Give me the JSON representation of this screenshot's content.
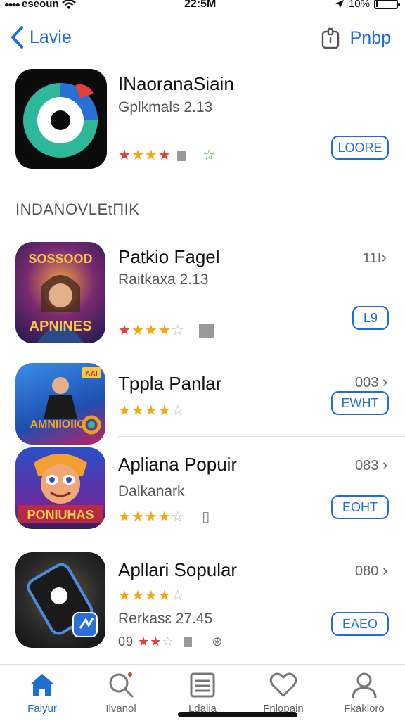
{
  "status_bar": {
    "carrier": "eseoun",
    "time": "22:5M",
    "battery": "10%"
  },
  "nav": {
    "back_label": "Lavie",
    "right_label": "Pnbp"
  },
  "featured": {
    "title": "INaoranaSiain",
    "subtitle": "Gplkmals 2.13",
    "button": "LOORE",
    "rating_text": "",
    "stars": [
      1,
      1,
      1,
      0.5,
      0
    ]
  },
  "section": {
    "header": "INDANOVLEtΠΙΚ"
  },
  "apps": [
    {
      "title": "Patkio Fagel",
      "subtitle": "Raitkaxa 2.13",
      "meta": "11І",
      "button": "L9",
      "icon_text_top": "SOSSOOD",
      "icon_text_bottom": "APNINES"
    },
    {
      "title": "Tppla Panlar",
      "subtitle": "",
      "meta": "003",
      "button": "EWНТ",
      "icon_text_top": "AAI",
      "icon_text_bottom": "AMNIIOIIO"
    },
    {
      "title": "Apliana Popuir",
      "subtitle": "Dalkanark",
      "meta": "083",
      "button": "EOНТ",
      "icon_text_top": "",
      "icon_text_bottom": "PONIUHAS"
    },
    {
      "title": "Apllari Sopular",
      "subtitle": "Rerkasε 27.45",
      "meta": "080",
      "button": "EAEO",
      "rating_prefix": "09",
      "icon_text_top": "",
      "icon_text_bottom": ""
    }
  ],
  "tabs": [
    {
      "label": "Faiyur"
    },
    {
      "label": "Ilvanol"
    },
    {
      "label": "Ldalia"
    },
    {
      "label": "Fnlopain"
    },
    {
      "label": "Fkakioro"
    }
  ]
}
